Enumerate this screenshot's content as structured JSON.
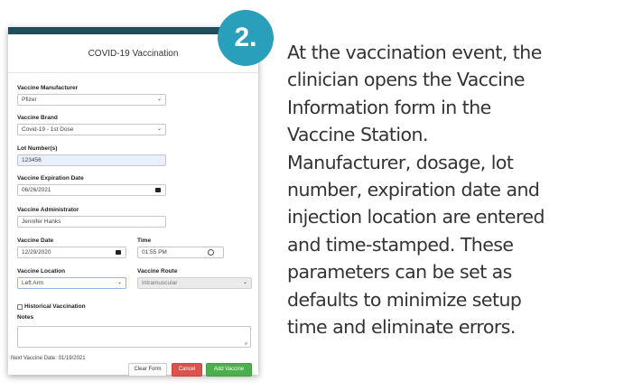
{
  "form": {
    "title": "COVID-19 Vaccination",
    "fields": {
      "manufacturer": {
        "label": "Vaccine Manufacturer",
        "value": "Pfizer"
      },
      "brand": {
        "label": "Vaccine Brand",
        "value": "Covid-19 - 1st Dose"
      },
      "lot": {
        "label": "Lot Number(s)",
        "value": "123456"
      },
      "expiration": {
        "label": "Vaccine Expiration Date",
        "value": "06/26/2021"
      },
      "administrator": {
        "label": "Vaccine Administrator",
        "value": "Jennifer Hanks"
      },
      "date": {
        "label": "Vaccine Date",
        "value": "12/29/2020"
      },
      "time": {
        "label": "Time",
        "value": "01:55 PM"
      },
      "location": {
        "label": "Vaccine Location",
        "value": "Left Arm"
      },
      "route": {
        "label": "Vaccine Route",
        "value": "Intramuscular"
      }
    },
    "historical_label": "Historical Vaccination",
    "notes_label": "Notes",
    "next_date": "Next Vaccine Date: 01/19/2021",
    "buttons": {
      "clear": "Clear Form",
      "cancel": "Cancel",
      "add": "Add Vaccine"
    }
  },
  "badge": {
    "number": "2.",
    "color": "#2a9fbc"
  },
  "description_lines": [
    "At the vaccination event, the",
    "clinician opens the Vaccine",
    "Information form in the",
    "Vaccine Station.",
    "Manufacturer, dosage, lot",
    "number, expiration date and",
    "injection location are entered",
    "and time-stamped. These",
    "parameters can be set as",
    "defaults to minimize setup",
    "time and eliminate errors."
  ],
  "icons": {
    "dropdown": "chevron-down-icon",
    "calendar": "calendar-icon",
    "clock": "clock-icon"
  },
  "colors": {
    "header_bar": "#1f4e5a",
    "cancel": "#d9534f",
    "add": "#4cae4c",
    "lot_field": "#e8f0fe"
  }
}
